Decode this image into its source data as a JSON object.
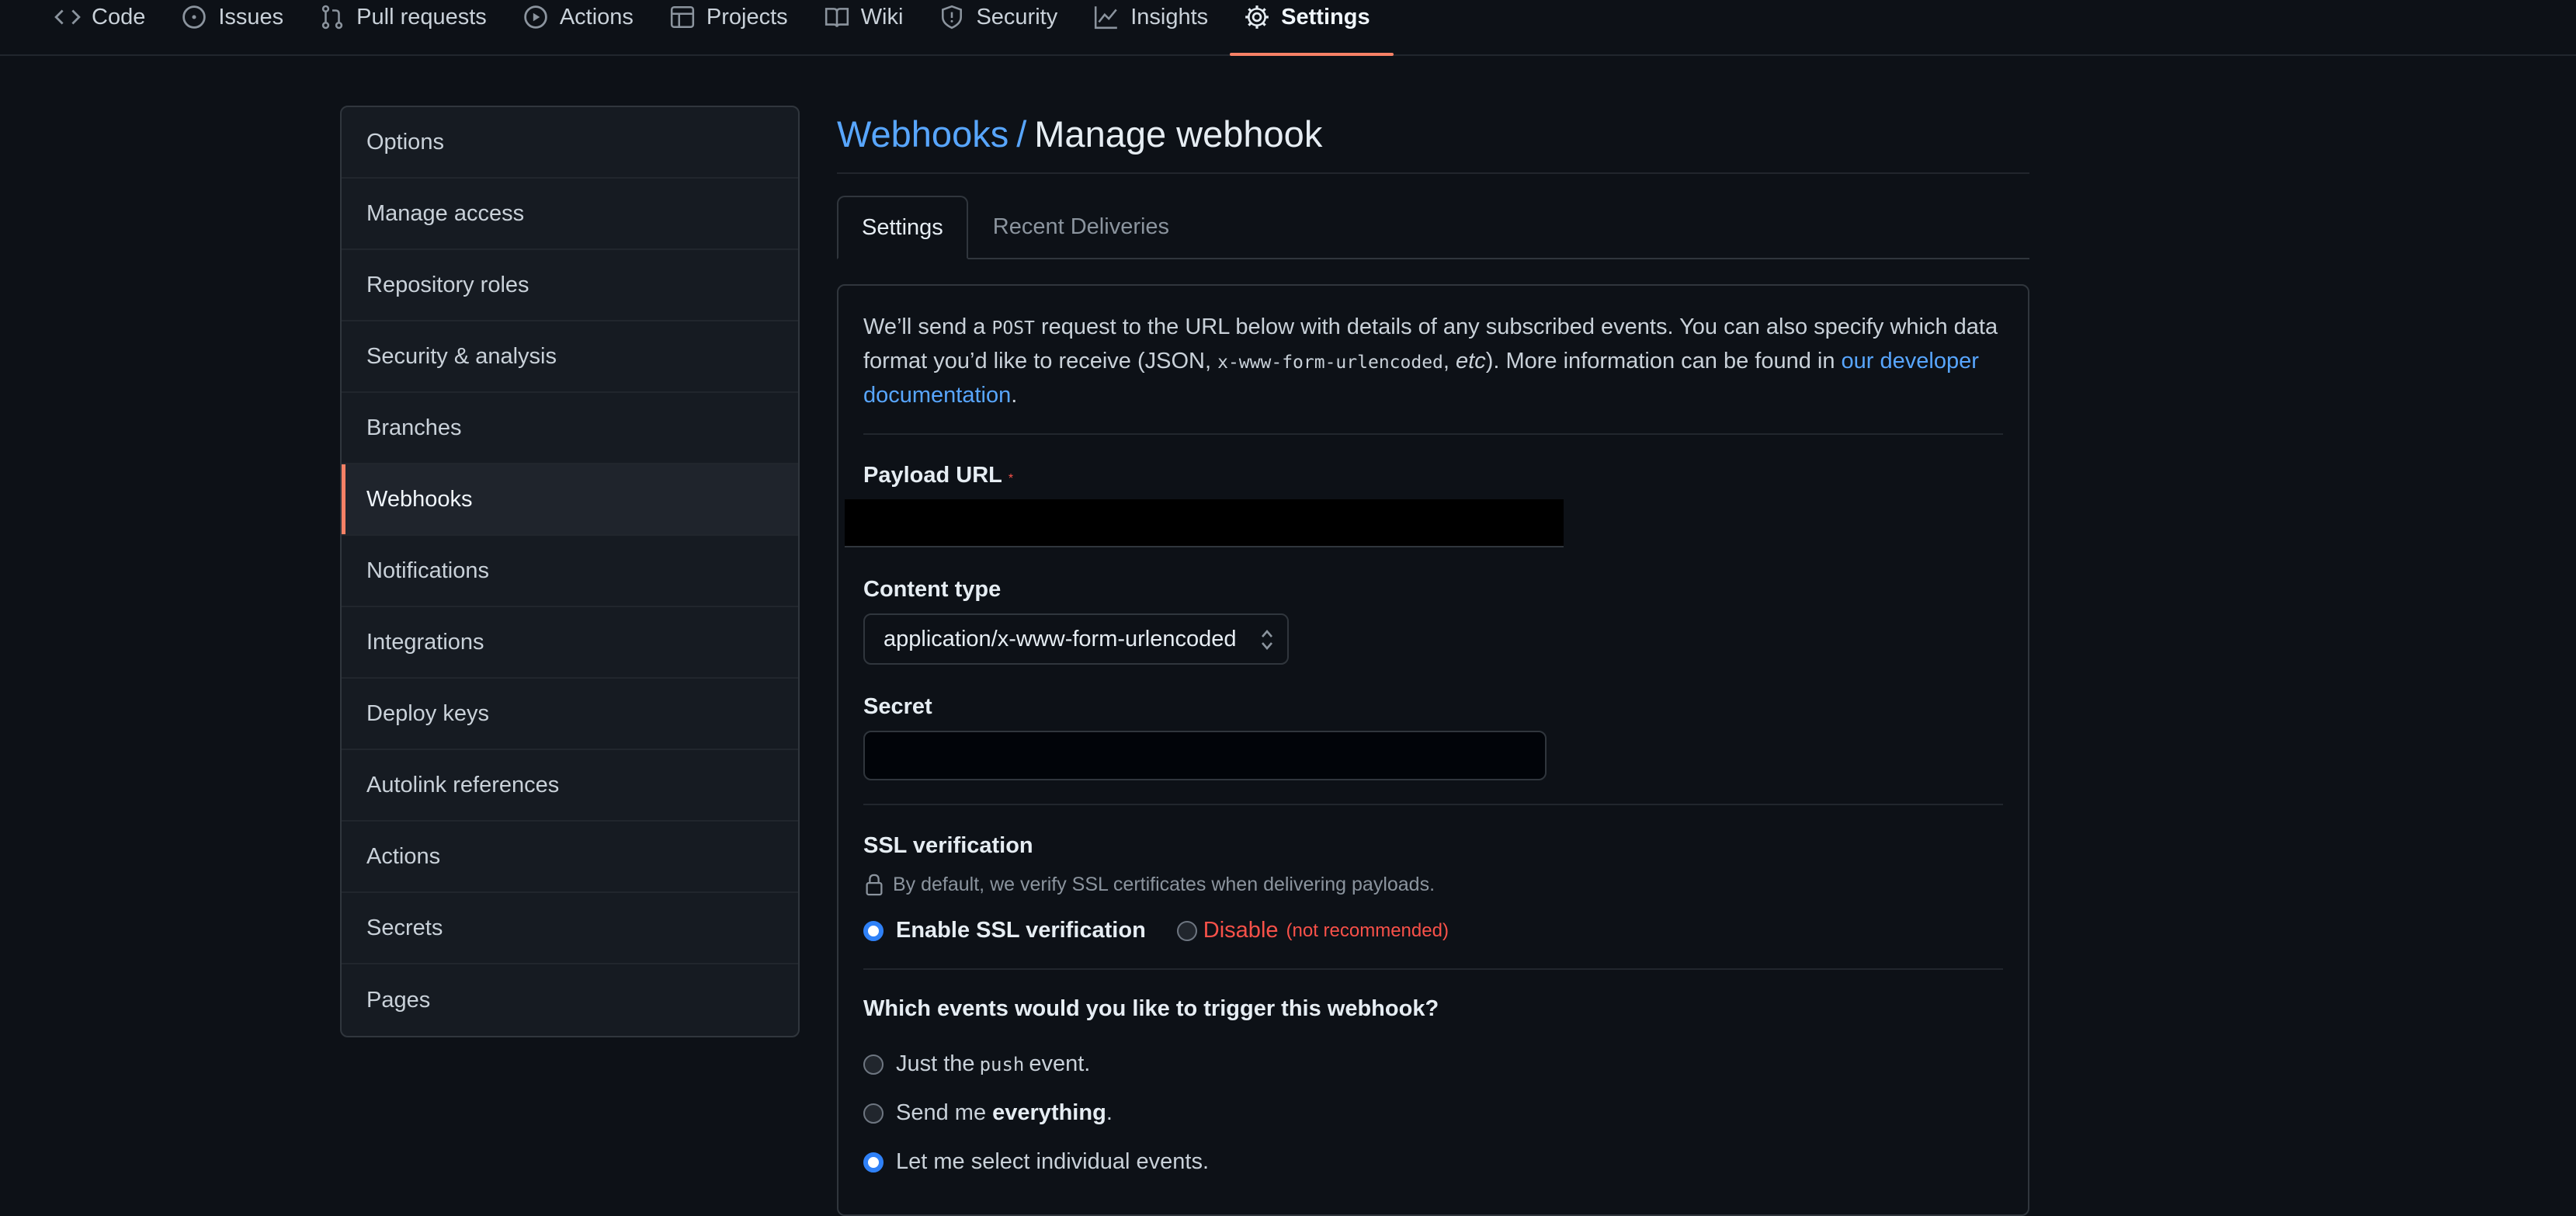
{
  "topnav": {
    "items": [
      {
        "label": "Code",
        "icon": "code-icon"
      },
      {
        "label": "Issues",
        "icon": "issue-icon"
      },
      {
        "label": "Pull requests",
        "icon": "pull-request-icon"
      },
      {
        "label": "Actions",
        "icon": "play-icon"
      },
      {
        "label": "Projects",
        "icon": "table-icon"
      },
      {
        "label": "Wiki",
        "icon": "book-icon"
      },
      {
        "label": "Security",
        "icon": "shield-icon"
      },
      {
        "label": "Insights",
        "icon": "graph-icon"
      },
      {
        "label": "Settings",
        "icon": "gear-icon",
        "active": true
      }
    ]
  },
  "sidebar": {
    "items": [
      {
        "label": "Options"
      },
      {
        "label": "Manage access"
      },
      {
        "label": "Repository roles"
      },
      {
        "label": "Security & analysis"
      },
      {
        "label": "Branches"
      },
      {
        "label": "Webhooks",
        "selected": true
      },
      {
        "label": "Notifications"
      },
      {
        "label": "Integrations"
      },
      {
        "label": "Deploy keys"
      },
      {
        "label": "Autolink references"
      },
      {
        "label": "Actions"
      },
      {
        "label": "Secrets"
      },
      {
        "label": "Pages"
      }
    ]
  },
  "header": {
    "crumb": "Webhooks",
    "separator": "/",
    "title": "Manage webhook"
  },
  "tabs": [
    {
      "label": "Settings",
      "active": true
    },
    {
      "label": "Recent Deliveries"
    }
  ],
  "intro": {
    "part1": "We’ll send a ",
    "post": "POST",
    "part2": " request to the URL below with details of any subscribed events. You can also specify which data format you’d like to receive (JSON, ",
    "format": "x-www-form-urlencoded",
    "part3": ", ",
    "etc": "etc",
    "part4": "). More information can be found in ",
    "link": "our developer documentation",
    "part5": "."
  },
  "form": {
    "payload_label": "Payload URL",
    "required_mark": "*",
    "content_type_label": "Content type",
    "content_type_value": "application/x-www-form-urlencoded",
    "secret_label": "Secret",
    "ssl_label": "SSL verification",
    "ssl_desc": "By default, we verify SSL certificates when delivering payloads.",
    "ssl_enable": "Enable SSL verification",
    "ssl_disable": "Disable",
    "ssl_not_recommended": "(not recommended)",
    "events_question": "Which events would you like to trigger this webhook?",
    "event_push_pre": "Just the",
    "event_push_code": "push",
    "event_push_post": "event.",
    "event_all_pre": "Send me",
    "event_all_bold": "everything",
    "event_all_post": ".",
    "event_select": "Let me select individual events."
  },
  "colors": {
    "background": "#0d1117",
    "accent_underline": "#f78166",
    "link": "#58a6ff",
    "danger": "#f85149",
    "radio_checked": "#2f81f7"
  }
}
